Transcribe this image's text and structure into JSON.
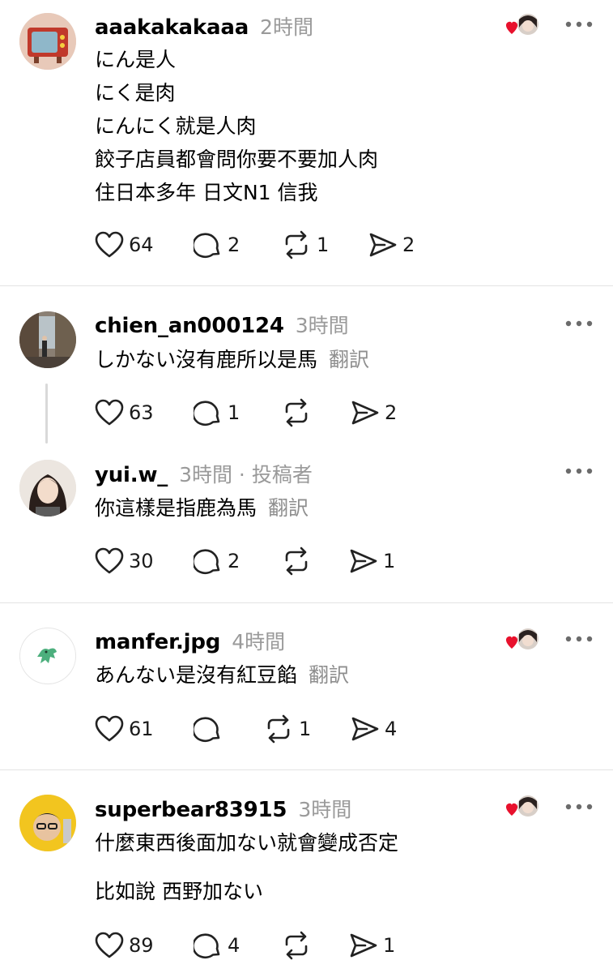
{
  "posts": [
    {
      "username": "aaakakakaaa",
      "time": "2時間",
      "lines": [
        "にん是人",
        "にく是肉",
        "にんにく就是人肉",
        "餃子店員都會問你要不要加人肉",
        "住日本多年 日文N1 信我"
      ],
      "likes": "64",
      "replies": "2",
      "reposts": "1",
      "shares": "2",
      "liked_by_author": true
    },
    {
      "username": "chien_an000124",
      "time": "3時間",
      "lines": [
        "しかない沒有鹿所以是馬"
      ],
      "translate": "翻訳",
      "likes": "63",
      "replies": "1",
      "reposts": "",
      "shares": "2"
    },
    {
      "username": "yui.w_",
      "time": "3時間 · 投稿者",
      "lines": [
        "你這樣是指鹿為馬"
      ],
      "translate": "翻訳",
      "likes": "30",
      "replies": "2",
      "reposts": "",
      "shares": "1"
    },
    {
      "username": "manfer.jpg",
      "time": "4時間",
      "lines": [
        "あんない是沒有紅豆餡"
      ],
      "translate": "翻訳",
      "likes": "61",
      "replies": "",
      "reposts": "1",
      "shares": "4",
      "liked_by_author": true
    },
    {
      "username": "superbear83915",
      "time": "3時間",
      "lines": [
        "什麼東西後面加ない就會變成否定",
        "比如說 西野加ない"
      ],
      "likes": "89",
      "replies": "4",
      "reposts": "",
      "shares": "1",
      "liked_by_author": true
    }
  ],
  "colors": {
    "heart": "#e8112d",
    "muted": "#9a9a9a",
    "divider": "#e3e3e3"
  },
  "icons": [
    "heart-icon",
    "comment-icon",
    "repost-icon",
    "share-icon",
    "more-icon"
  ]
}
